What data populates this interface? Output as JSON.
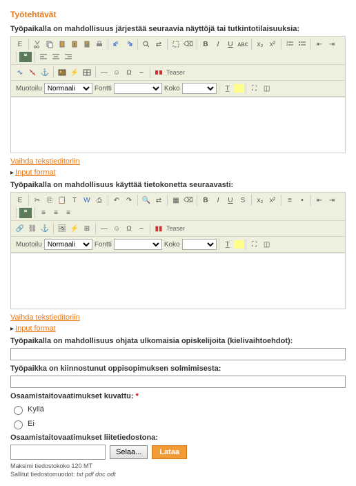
{
  "section_title": "Työtehtävät",
  "editor1": {
    "label": "Työpaikalla on mahdollisuus järjestää seuraavia näyttöjä tai tutkintotilaisuuksia:",
    "switch_link": "Vaihda tekstieditoriin",
    "format_link": "Input format"
  },
  "editor2": {
    "label": "Työpaikalla on mahdollisuus käyttää tietokonetta seuraavasti:",
    "switch_link": "Vaihda tekstieditoriin",
    "format_link": "Input format"
  },
  "field_foreign": {
    "label": "Työpaikalla on mahdollisuus ohjata ulkomaisia opiskelijoita (kielivaihtoehdot):",
    "value": ""
  },
  "field_contract": {
    "label": "Työpaikka on kiinnostunut oppisopimuksen solmimisesta:",
    "value": ""
  },
  "req_desc": {
    "label": "Osaamistaitovaatimukset kuvattu:"
  },
  "radio_yes": "Kyllä",
  "radio_no": "Ei",
  "attach": {
    "label": "Osaamistaitovaatimukset liitetiedostona:",
    "browse": "Selaa...",
    "upload": "Lataa",
    "hint1": "Maksimi tiedostokoko 120 MT",
    "hint2": "Sallitut tiedostomuodot: txt pdf doc odt"
  },
  "tb": {
    "format": "Muotoilu",
    "format_val": "Normaali",
    "font": "Fontti",
    "size": "Koko",
    "teaser": "Teaser"
  }
}
